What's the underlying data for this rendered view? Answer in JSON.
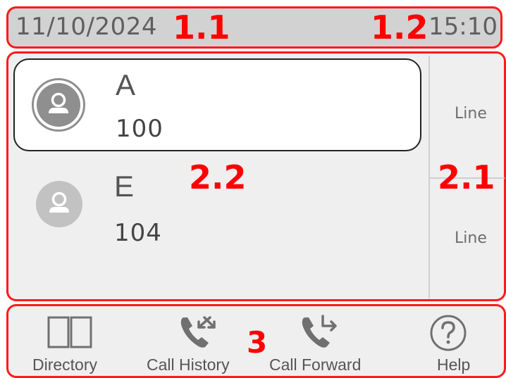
{
  "status_bar": {
    "date": "11/10/2024",
    "time": "15:10"
  },
  "annotations": {
    "date": "1.1",
    "time": "1.2",
    "lines": "2.1",
    "contacts": "2.2",
    "softkeys": "3"
  },
  "lines": [
    {
      "label": "Line"
    },
    {
      "label": "Line"
    }
  ],
  "contacts": [
    {
      "name": "A",
      "number": "100",
      "selected": true
    },
    {
      "name": "E",
      "number": "104",
      "selected": false
    }
  ],
  "softkeys": [
    {
      "label": "Directory",
      "icon": "book-icon"
    },
    {
      "label": "Call History",
      "icon": "call-history-icon"
    },
    {
      "label": "Call Forward",
      "icon": "call-forward-icon"
    },
    {
      "label": "Help",
      "icon": "help-icon"
    }
  ],
  "colors": {
    "annotation": "#ff0000",
    "status_bg": "#d2d2d2",
    "panel_bg": "#efefef"
  }
}
